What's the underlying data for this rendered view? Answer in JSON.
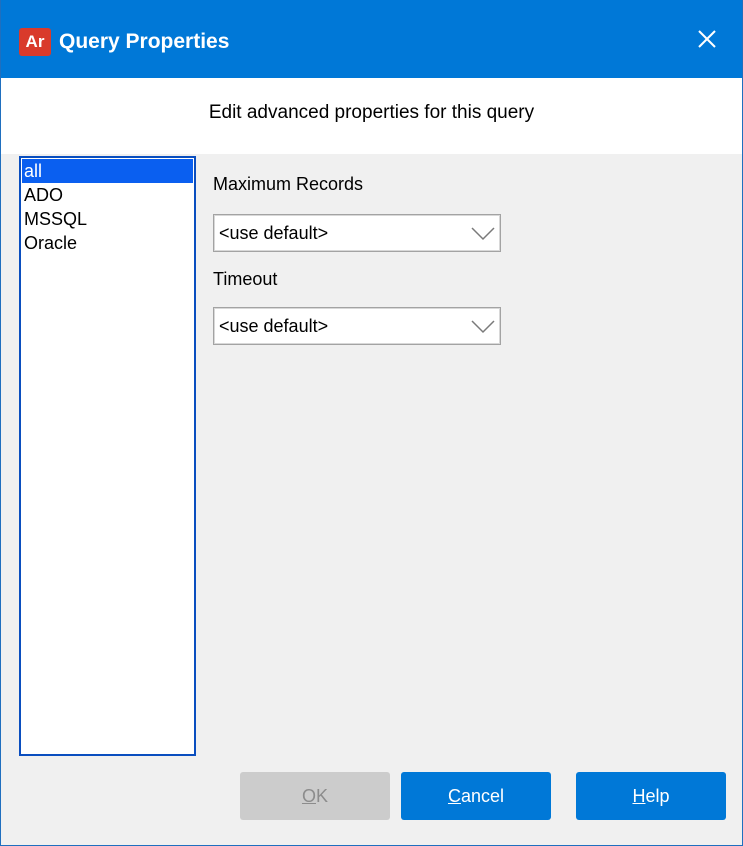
{
  "window": {
    "app_icon_text": "Ar",
    "title": "Query Properties",
    "close_icon": "close-icon"
  },
  "header": {
    "text": "Edit advanced properties for this query"
  },
  "list": {
    "items": [
      {
        "label": "all",
        "selected": true
      },
      {
        "label": "ADO",
        "selected": false
      },
      {
        "label": "MSSQL",
        "selected": false
      },
      {
        "label": "Oracle",
        "selected": false
      }
    ]
  },
  "fields": {
    "max_records": {
      "label": "Maximum Records",
      "value": "<use default>"
    },
    "timeout": {
      "label": "Timeout",
      "value": "<use default>"
    }
  },
  "buttons": {
    "ok": {
      "mnemonic": "O",
      "rest": "K",
      "enabled": false
    },
    "cancel": {
      "mnemonic": "C",
      "rest": "ancel"
    },
    "help": {
      "mnemonic": "H",
      "rest": "elp"
    }
  },
  "colors": {
    "titlebar": "#0078d7",
    "selection": "#0a5ff0",
    "button_primary": "#0078d7",
    "button_disabled": "#cccccc"
  }
}
